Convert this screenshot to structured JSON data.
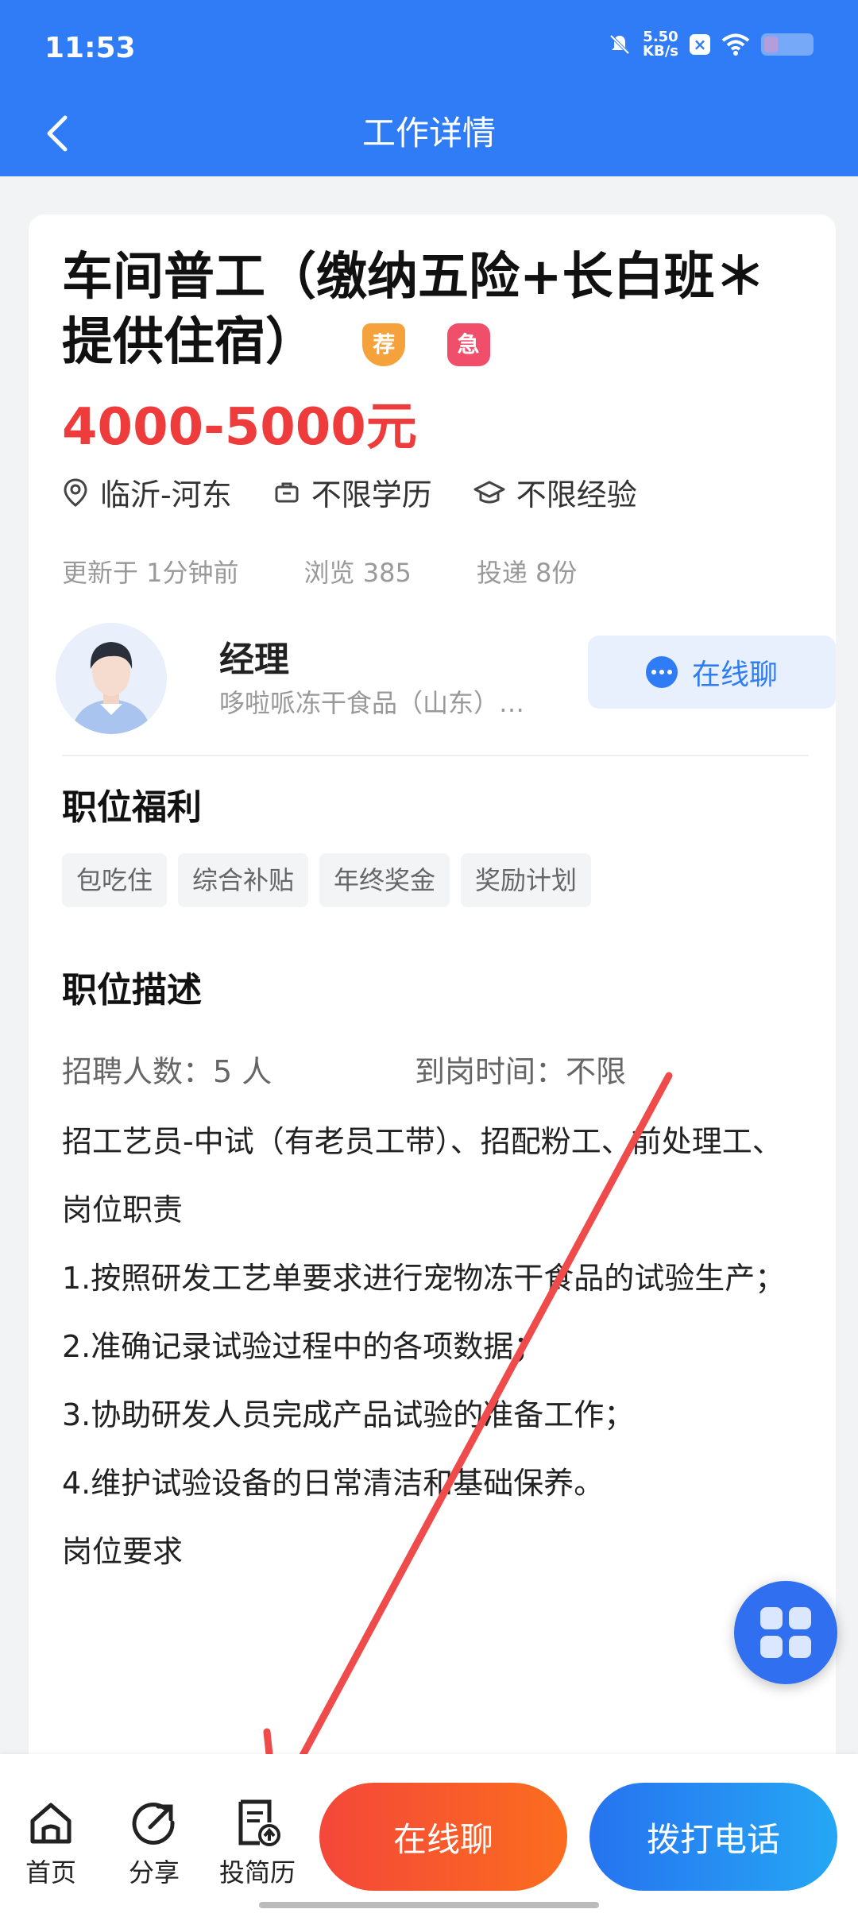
{
  "status_bar": {
    "time": "11:53",
    "speed_value": "5.50",
    "speed_unit": "KB/s",
    "battery_level": 0.3
  },
  "header": {
    "title": "工作详情"
  },
  "job": {
    "title": "车间普工（缴纳五险+长白班＊提供住宿）",
    "badge_recommended": "荐",
    "badge_urgent": "急",
    "salary": "4000-5000元",
    "location": "临沂-河东",
    "education": "不限学历",
    "experience": "不限经验",
    "updated": "更新于 1分钟前",
    "views": "浏览 385",
    "applications": "投递 8份"
  },
  "recruiter": {
    "name": "经理",
    "company": "哆啦哌冻干食品（山东）…",
    "chat_label": "在线聊"
  },
  "benefits": {
    "title": "职位福利",
    "tags": [
      "包吃住",
      "综合补贴",
      "年终奖金",
      "奖励计划"
    ]
  },
  "description": {
    "title": "职位描述",
    "headcount": "招聘人数：5 人",
    "start_time": "到岗时间：不限",
    "lines": [
      "招工艺员-中试（有老员工带）、招配粉工、前处理工、",
      "岗位职责",
      "1.按照研发工艺单要求进行宠物冻干食品的试验生产；",
      "2.准确记录试验过程中的各项数据；",
      "3.协助研发人员完成产品试验的准备工作；",
      "4.维护试验设备的日常清洁和基础保养。",
      "岗位要求"
    ]
  },
  "bottom_bar": {
    "home": "首页",
    "share": "分享",
    "resume": "投简历",
    "chat": "在线聊",
    "call": "拨打电话"
  },
  "colors": {
    "primary": "#2f7cf6",
    "salary": "#ee3b3b",
    "chat_gradient": [
      "#f4473a",
      "#fb6d1e"
    ],
    "call_gradient": [
      "#2673f0",
      "#26a7f4"
    ],
    "annotation_arrow": "#ef4b4b"
  }
}
